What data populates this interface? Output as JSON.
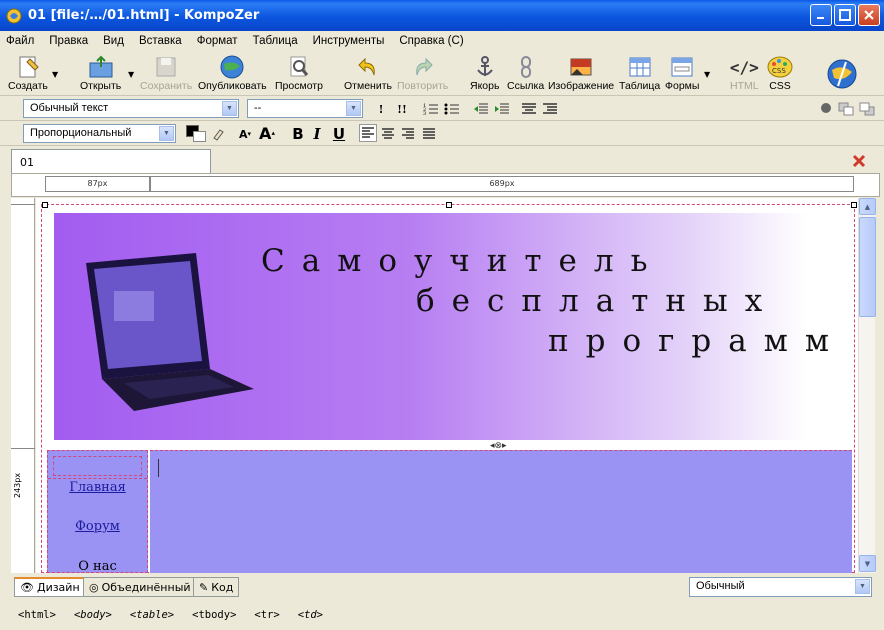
{
  "window": {
    "title": "01 [file:/…/01.html] - KompoZer"
  },
  "menu": [
    "Файл",
    "Правка",
    "Вид",
    "Вставка",
    "Формат",
    "Таблица",
    "Инструменты",
    "Справка (C)"
  ],
  "toolbar": {
    "create": "Создать",
    "open": "Открыть",
    "save": "Сохранить",
    "publish": "Опубликовать",
    "preview": "Просмотр",
    "undo": "Отменить",
    "redo": "Повторить",
    "anchor": "Якорь",
    "link": "Ссылка",
    "image": "Изображение",
    "table": "Таблица",
    "forms": "Формы",
    "html": "HTML",
    "css": "CSS"
  },
  "format": {
    "paragraph_style": "Обычный текст",
    "class_select": "--",
    "font": "Пропорциональный",
    "bold": "B",
    "italic": "I",
    "underline": "U"
  },
  "tab": {
    "name": "01"
  },
  "ruler": {
    "col1": "87px",
    "col2": "689px",
    "row1": "243px"
  },
  "content": {
    "banner_lines": [
      "Самоучитель",
      "бесплатных",
      "программ"
    ],
    "nav": [
      "Главная",
      "Форум",
      "О нас"
    ]
  },
  "view_tabs": {
    "design": "Дизайн",
    "combined": "Объединённый",
    "code": "Код"
  },
  "view_mode": "Обычный",
  "breadcrumb": [
    "<html>",
    "<body>",
    "<table>",
    "<tbody>",
    "<tr>",
    "<td>"
  ],
  "colors": {
    "title_bar": "#0a58e6",
    "cell_bg": "#9b93f3",
    "banner_start": "#a25cf0",
    "border": "#d2467a"
  }
}
